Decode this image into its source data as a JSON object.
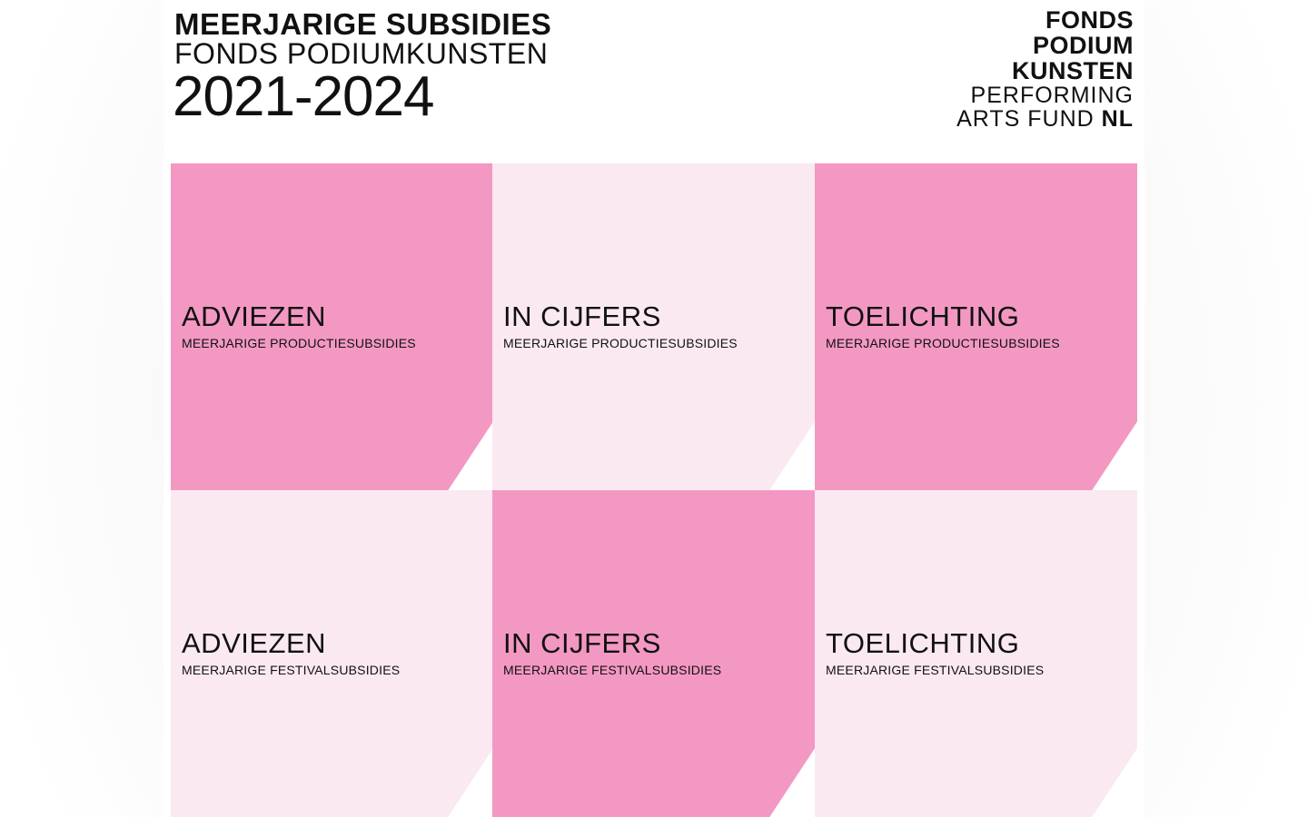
{
  "header": {
    "title_line1": "MEERJARIGE SUBSIDIES",
    "title_line2": "FONDS PODIUMKUNSTEN",
    "years": "2021-2024"
  },
  "logo": {
    "line1": "FONDS",
    "line2": "PODIUM",
    "line3": "KUNSTEN",
    "line4": "PERFORMING",
    "line5_prefix": "ARTS FUND ",
    "line5_suffix": "NL"
  },
  "colors": {
    "tile_dark": "#f398c3",
    "tile_light": "#fbe9f2",
    "text": "#111111"
  },
  "tiles": [
    {
      "label": "ADVIEZEN",
      "sub": "MEERJARIGE PRODUCTIESUBSIDIES"
    },
    {
      "label": "IN CIJFERS",
      "sub": "MEERJARIGE PRODUCTIESUBSIDIES"
    },
    {
      "label": "TOELICHTING",
      "sub": "MEERJARIGE PRODUCTIESUBSIDIES"
    },
    {
      "label": "ADVIEZEN",
      "sub": "MEERJARIGE FESTIVALSUBSIDIES"
    },
    {
      "label": "IN CIJFERS",
      "sub": "MEERJARIGE FESTIVALSUBSIDIES"
    },
    {
      "label": "TOELICHTING",
      "sub": "MEERJARIGE FESTIVALSUBSIDIES"
    }
  ]
}
